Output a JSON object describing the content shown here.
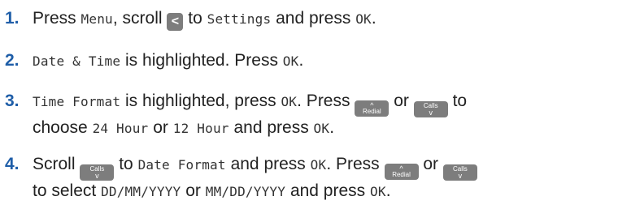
{
  "accent_color": "#1f5ea8",
  "step_number_color": "#1f5ea8",
  "keys": {
    "back_glyph": "<",
    "up_glyph": "^",
    "down_glyph": "v",
    "redial_label": "Redial",
    "calls_label": "Calls"
  },
  "steps": [
    {
      "num": "1.",
      "t1": "Press",
      "d1": "Menu",
      "t2": ", scroll",
      "t3": "to",
      "d2": "Settings",
      "t4": "and press",
      "d3": "OK",
      "t5": "."
    },
    {
      "num": "2.",
      "d1": "Date & Time",
      "t1": "is highlighted. Press",
      "d2": "OK",
      "t2": "."
    },
    {
      "num": "3.",
      "d1": "Time Format",
      "t1": "is highlighted, press",
      "d2": "OK",
      "t2": ". Press",
      "t3": "or",
      "t4": "to",
      "t5": "choose",
      "d3": "24 Hour",
      "t6": "or",
      "d4": "12 Hour",
      "t7": "and press",
      "d5": "OK",
      "t8": "."
    },
    {
      "num": "4.",
      "t1": "Scroll",
      "t2": "to",
      "d1": "Date Format",
      "t3": "and press",
      "d2": "OK",
      "t4": ". Press",
      "t5": "or",
      "t6": "to select",
      "d3": "DD/MM/YYYY",
      "t7": "or",
      "d4": "MM/DD/YYYY",
      "t8": "and press",
      "d5": "OK",
      "t9": "."
    }
  ]
}
